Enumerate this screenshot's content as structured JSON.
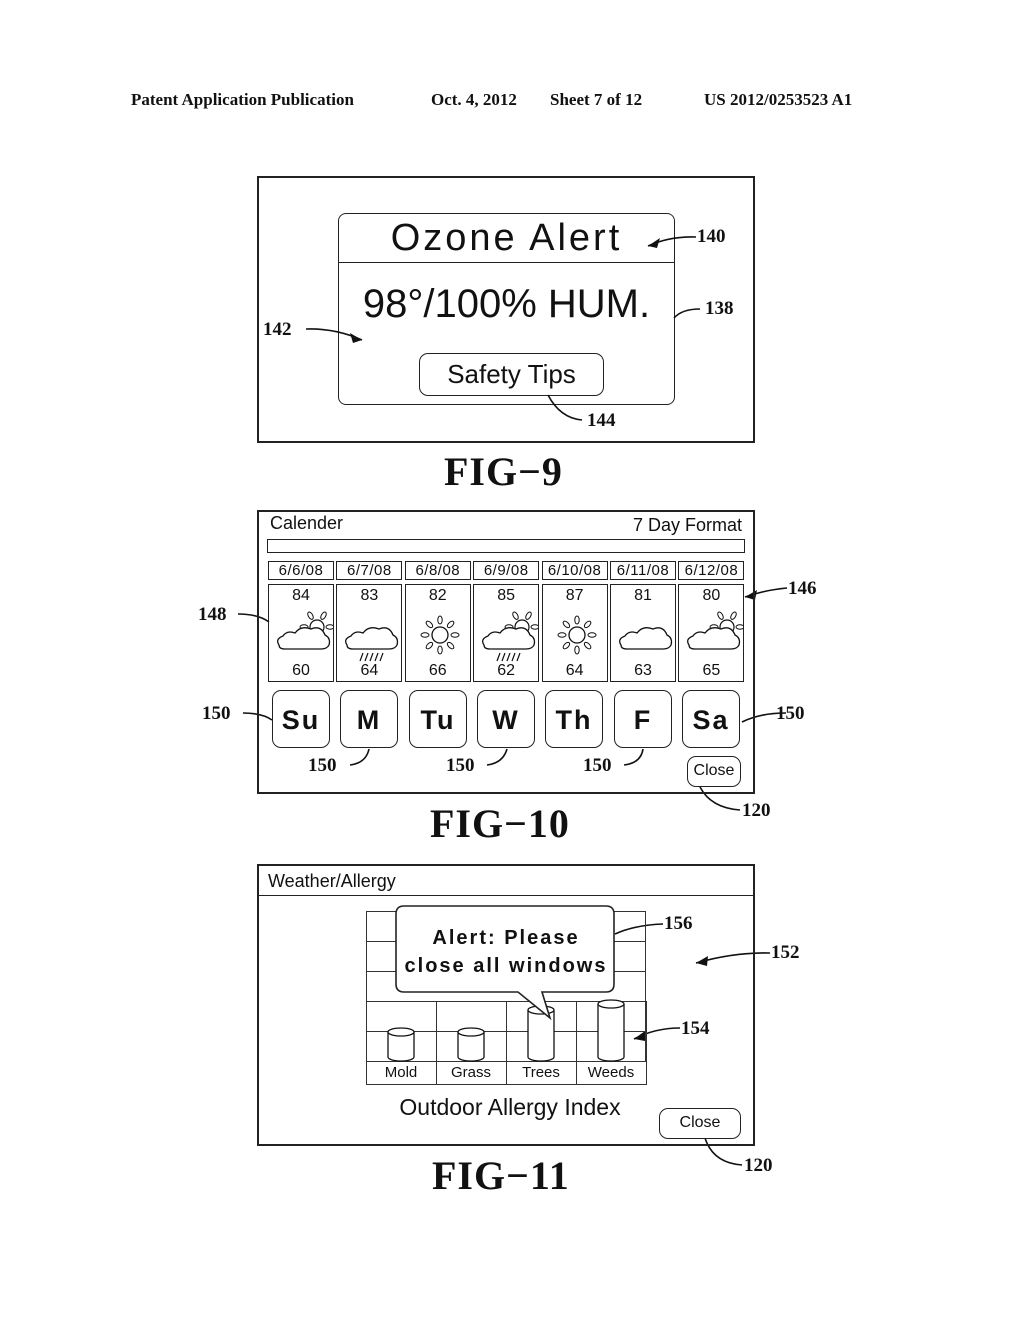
{
  "header": {
    "publication": "Patent Application Publication",
    "date": "Oct. 4, 2012",
    "sheet": "Sheet 7 of 12",
    "number": "US 2012/0253523 A1"
  },
  "fig9": {
    "label": "FIG−9",
    "dialog_title": "Ozone Alert",
    "reading": "98°/100% HUM.",
    "button": "Safety Tips",
    "refs": {
      "alert_title": "140",
      "dialog": "138",
      "reading_area": "142",
      "button": "144"
    }
  },
  "fig10": {
    "label": "FIG−10",
    "title": "Calender",
    "format": "7 Day Format",
    "days": [
      {
        "date": "6/6/08",
        "high": "84",
        "low": "60",
        "icon": "partly-cloudy-icon"
      },
      {
        "date": "6/7/08",
        "high": "83",
        "low": "64",
        "icon": "rain-cloud-icon"
      },
      {
        "date": "6/8/08",
        "high": "82",
        "low": "66",
        "icon": "sun-icon"
      },
      {
        "date": "6/9/08",
        "high": "85",
        "low": "62",
        "icon": "partly-cloudy-rain-icon"
      },
      {
        "date": "6/10/08",
        "high": "87",
        "low": "64",
        "icon": "sun-icon"
      },
      {
        "date": "6/11/08",
        "high": "81",
        "low": "63",
        "icon": "cloud-icon"
      },
      {
        "date": "6/12/08",
        "high": "80",
        "low": "65",
        "icon": "partly-cloudy-icon"
      }
    ],
    "day_buttons": [
      "Su",
      "M",
      "Tu",
      "W",
      "Th",
      "F",
      "Sa"
    ],
    "close": "Close",
    "refs": {
      "forecast": "146",
      "day_cell": "148",
      "day_button": "150",
      "close": "120"
    }
  },
  "fig11": {
    "label": "FIG−11",
    "title": "Weather/Allergy",
    "alert": [
      "Alert: Please",
      "close all windows"
    ],
    "categories": [
      "Mold",
      "Grass",
      "Trees",
      "Weeds"
    ],
    "levels": [
      1,
      1,
      2,
      2.3
    ],
    "level_max": 4,
    "caption": "Outdoor Allergy Index",
    "close": "Close",
    "refs": {
      "alert": "156",
      "screen": "152",
      "chart": "154",
      "close": "120"
    }
  }
}
